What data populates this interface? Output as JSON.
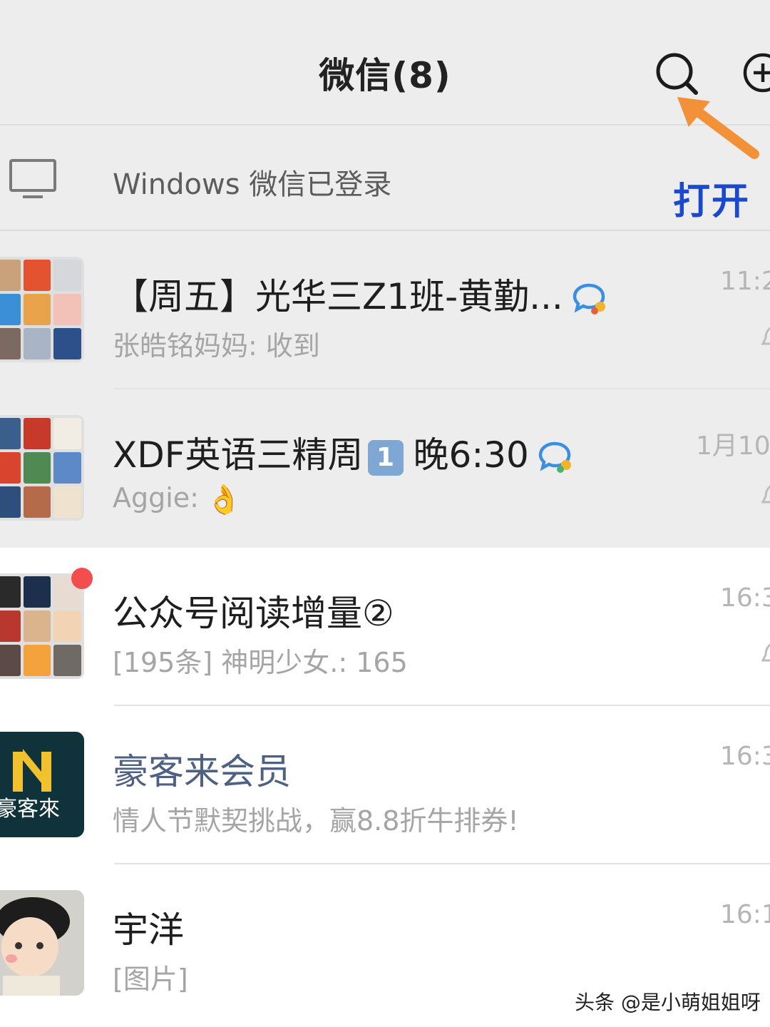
{
  "header": {
    "title": "微信(8)",
    "search_icon": "search-icon",
    "add_icon": "plus-circle-icon"
  },
  "annotation": {
    "label": "打开",
    "arrow_color": "#f29138",
    "label_color": "#1a49d0"
  },
  "windows_bar": {
    "icon": "monitor-icon",
    "text": "Windows 微信已登录"
  },
  "chats": [
    {
      "name": "【周五】光华三Z1班-黄勤...",
      "preview": "张皓铭妈妈: 收到",
      "time": "11:2",
      "pinned": true,
      "muted": true,
      "group_chat_icon": true
    },
    {
      "name_prefix": "XDF英语三精周",
      "name_badge": "1",
      "name_suffix": "晚6:30",
      "preview": "Aggie:",
      "preview_emoji": "👌",
      "time": "1月10",
      "pinned": true,
      "muted": true,
      "group_chat_icon": true
    },
    {
      "name": "公众号阅读增量②",
      "preview": "[195条] 神明少女.: 165",
      "time": "16:3",
      "pinned": false,
      "muted": true,
      "unread_dot": true
    },
    {
      "name": "豪客来会员",
      "preview": "情人节默契挑战，赢8.8折牛排券!",
      "time": "16:3",
      "pinned": false,
      "official_account": true,
      "avatar_text": "豪客來"
    },
    {
      "name": "宇洋",
      "preview": "[图片]",
      "time": "16:1",
      "pinned": false
    }
  ],
  "watermark": "头条 @是小萌姐姐呀",
  "colors": {
    "header_bg": "#ededed",
    "pinned_bg": "#ededed",
    "official_name": "#4e6183",
    "unread_dot": "#f24e4e"
  }
}
